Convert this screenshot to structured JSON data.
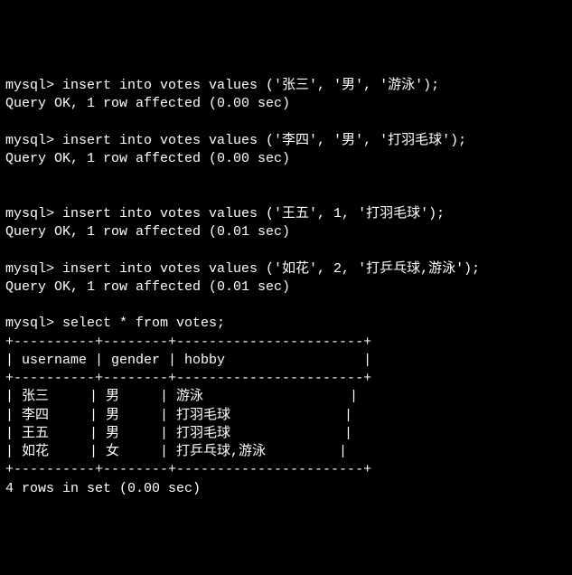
{
  "prompt": "mysql> ",
  "inserts": [
    {
      "cmd": "insert into votes values ('张三', '男', '游泳');",
      "result": "Query OK, 1 row affected (0.00 sec)"
    },
    {
      "cmd": "insert into votes values ('李四', '男', '打羽毛球');",
      "result": "Query OK, 1 row affected (0.00 sec)"
    },
    {
      "cmd": "insert into votes values ('王五', 1, '打羽毛球');",
      "result": "Query OK, 1 row affected (0.01 sec)"
    },
    {
      "cmd": "insert into votes values ('如花', 2, '打乒乓球,游泳');",
      "result": "Query OK, 1 row affected (0.01 sec)"
    }
  ],
  "select": {
    "cmd": "select * from votes;",
    "border": "+----------+--------+-----------------------+",
    "header": "| username | gender | hobby                 |",
    "rows": [
      "| 张三     | 男     | 游泳                  |",
      "| 李四     | 男     | 打羽毛球              |",
      "| 王五     | 男     | 打羽毛球              |",
      "| 如花     | 女     | 打乒乓球,游泳         |"
    ],
    "footer": "4 rows in set (0.00 sec)"
  },
  "chart_data": {
    "type": "table",
    "title": "votes",
    "columns": [
      "username",
      "gender",
      "hobby"
    ],
    "rows": [
      [
        "张三",
        "男",
        "游泳"
      ],
      [
        "李四",
        "男",
        "打羽毛球"
      ],
      [
        "王五",
        "男",
        "打羽毛球"
      ],
      [
        "如花",
        "女",
        "打乒乓球,游泳"
      ]
    ]
  }
}
